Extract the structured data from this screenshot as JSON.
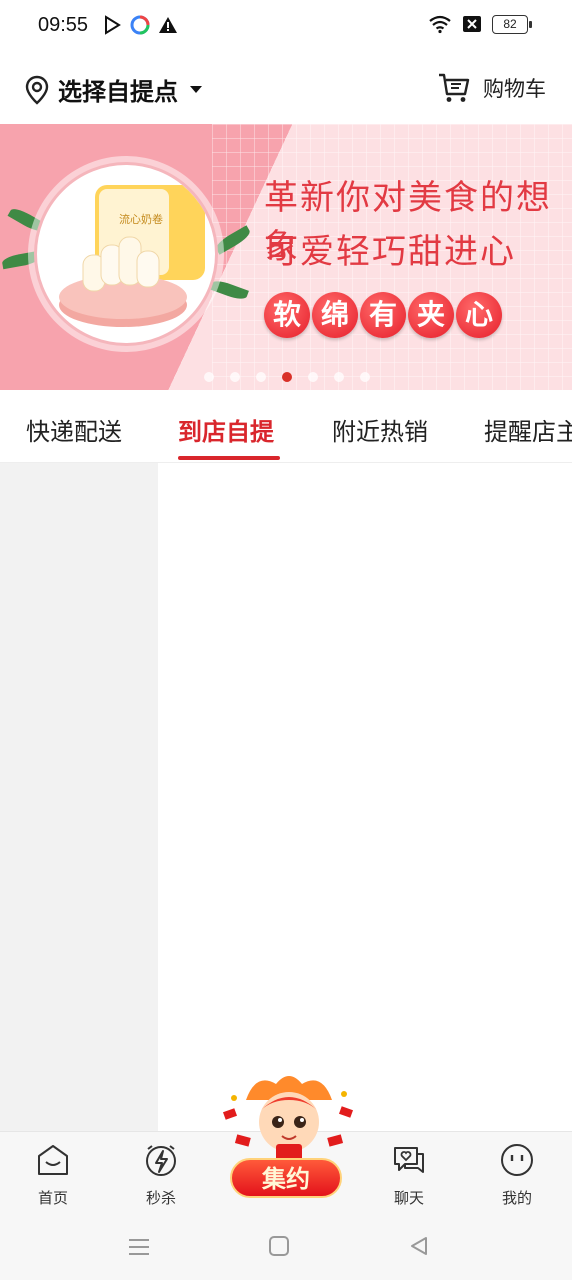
{
  "status_bar": {
    "time": "09:55",
    "battery": "82"
  },
  "header": {
    "location_label": "选择自提点",
    "cart_label": "购物车"
  },
  "banner": {
    "headline_line1": "革新你对美食的想象",
    "headline_line2": "可爱轻巧甜进心",
    "pills": [
      "软",
      "绵",
      "有",
      "夹",
      "心"
    ],
    "product_text": "流心奶卷",
    "slide_count": 7,
    "active_slide": 4
  },
  "tabs": [
    {
      "label": "快递配送",
      "active": false
    },
    {
      "label": "到店自提",
      "active": true
    },
    {
      "label": "附近热销",
      "active": false
    },
    {
      "label": "提醒店主",
      "active": false
    }
  ],
  "bottom_nav": {
    "home": "首页",
    "flash_sale": "秒杀",
    "promo": "集约",
    "chat": "聊天",
    "mine": "我的"
  },
  "colors": {
    "accent": "#d9262c",
    "banner_pink": "#f7a3ad"
  }
}
